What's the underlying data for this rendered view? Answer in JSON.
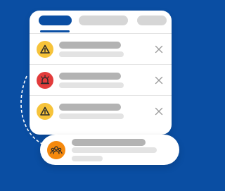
{
  "colors": {
    "background": "#0a4ea3",
    "tab_active": "#0a4ea3",
    "warning": "#f6c33a",
    "alarm": "#e23b3b",
    "team": "#f5890d",
    "close": "#9a9a9a"
  },
  "tabs": [
    {
      "state": "active"
    },
    {
      "state": "inactive"
    },
    {
      "state": "inactive"
    }
  ],
  "notifications": [
    {
      "icon": "warning-icon",
      "color": "#f6c33a"
    },
    {
      "icon": "siren-icon",
      "color": "#e23b3b"
    },
    {
      "icon": "warning-icon",
      "color": "#f6c33a"
    }
  ],
  "card": {
    "icon": "team-icon",
    "color": "#f5890d"
  }
}
